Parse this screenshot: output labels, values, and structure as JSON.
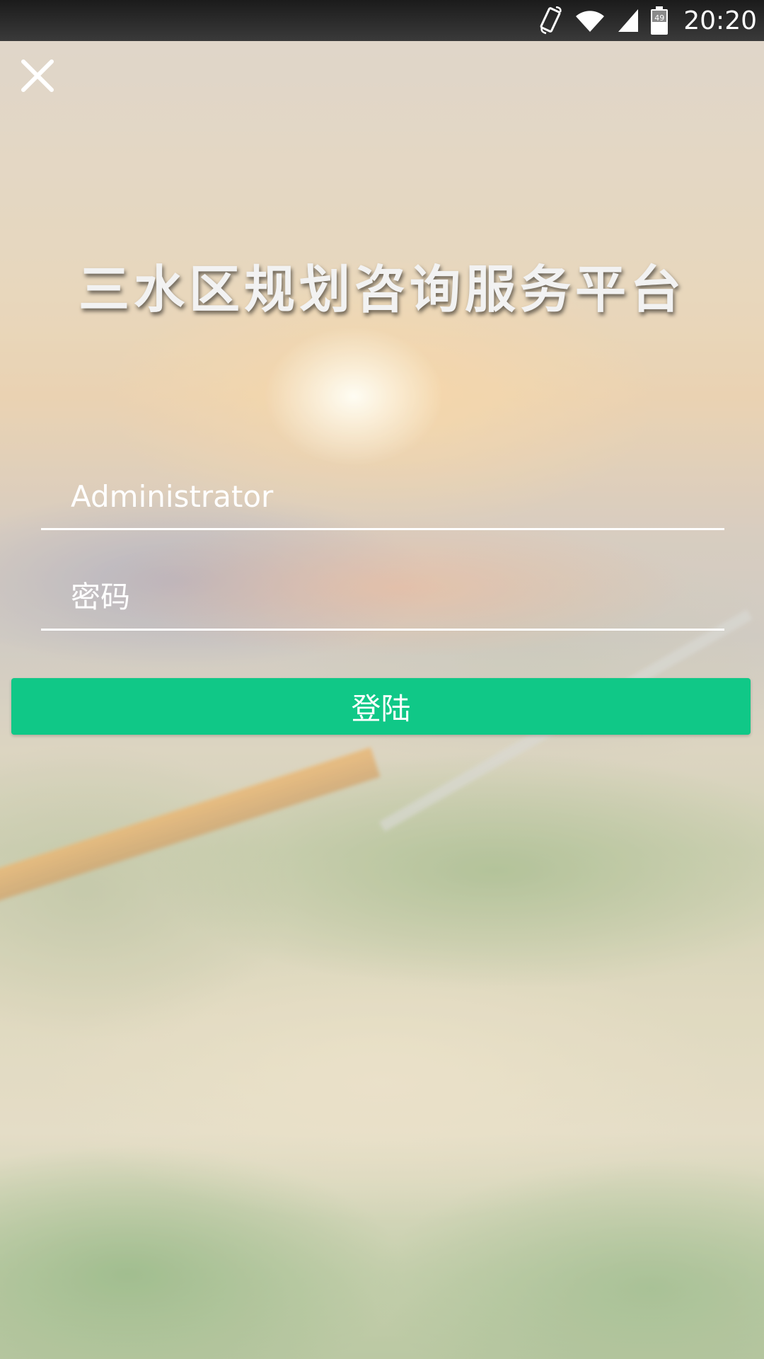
{
  "status_bar": {
    "time": "20:20",
    "battery_level": "49",
    "icons": [
      "rotate-icon",
      "wifi-icon",
      "signal-icon",
      "battery-icon"
    ]
  },
  "header": {
    "close_icon": "close-icon"
  },
  "login": {
    "title": "三水区规划咨询服务平台",
    "username_value": "Administrator",
    "password_placeholder": "密码",
    "submit_label": "登陆"
  },
  "colors": {
    "accent": "#10c887",
    "text": "#ffffff",
    "status_bar": "#2a2a2a"
  }
}
